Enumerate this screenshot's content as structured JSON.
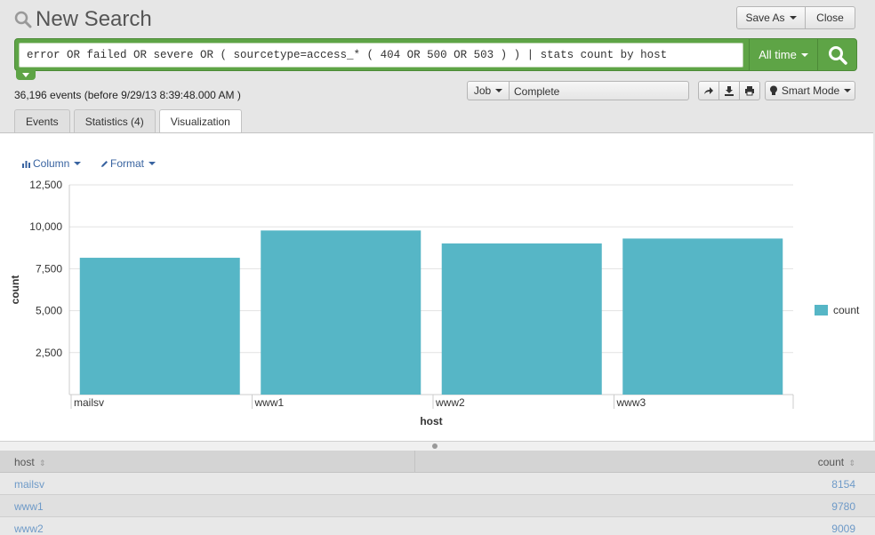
{
  "header": {
    "title": "New Search",
    "save_as_label": "Save As",
    "close_label": "Close"
  },
  "search": {
    "query": "error OR failed OR severe OR ( sourcetype=access_* ( 404 OR 500 OR 503 ) ) | stats count by host",
    "time_range_label": "All time"
  },
  "status": {
    "event_count_text": "36,196 events (before 9/29/13 8:39:48.000 AM )",
    "job_label": "Job",
    "job_status": "Complete",
    "mode_label": "Smart Mode"
  },
  "tabs": [
    {
      "label": "Events"
    },
    {
      "label": "Statistics (4)"
    },
    {
      "label": "Visualization"
    }
  ],
  "viz_toolbar": {
    "chart_type_label": "Column",
    "format_label": "Format"
  },
  "colors": {
    "accent_green": "#5ea446",
    "bar_color": "#56b6c6",
    "link_blue": "#3863a0"
  },
  "chart_data": {
    "type": "bar",
    "categories": [
      "mailsv",
      "www1",
      "www2",
      "www3"
    ],
    "series": [
      {
        "name": "count",
        "values": [
          8154,
          9780,
          9009,
          9300
        ]
      }
    ],
    "xlabel": "host",
    "ylabel": "count",
    "yticks": [
      "2,500",
      "5,000",
      "7,500",
      "10,000",
      "12,500"
    ],
    "ytick_values": [
      2500,
      5000,
      7500,
      10000,
      12500
    ],
    "ylim": [
      0,
      12500
    ],
    "grid": true,
    "legend_position": "right"
  },
  "table": {
    "headers": {
      "host": "host",
      "count": "count"
    },
    "rows": [
      {
        "host": "mailsv",
        "count": "8154"
      },
      {
        "host": "www1",
        "count": "9780"
      },
      {
        "host": "www2",
        "count": "9009"
      }
    ]
  }
}
